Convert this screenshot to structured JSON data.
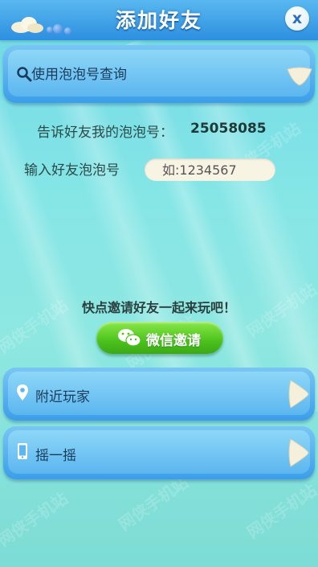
{
  "header": {
    "title": "添加好友",
    "close_label": "x"
  },
  "search": {
    "label": "使用泡泡号查询"
  },
  "my_id": {
    "label": "告诉好友我的泡泡号：",
    "value": "25058085"
  },
  "friend_input": {
    "label": "输入好友泡泡号",
    "placeholder": "如:1234567"
  },
  "invite": {
    "prompt": "快点邀请好友一起来玩吧！",
    "wechat_button": "微信邀请"
  },
  "options": [
    {
      "label": "附近玩家",
      "icon": "location-pin-icon"
    },
    {
      "label": "摇一摇",
      "icon": "phone-icon"
    }
  ],
  "watermark": "网侠手机站",
  "colors": {
    "header": "#2d8fe0",
    "panel": "#5cb6ef",
    "wechat_green": "#4cc21d",
    "background": "#86e6e6"
  }
}
